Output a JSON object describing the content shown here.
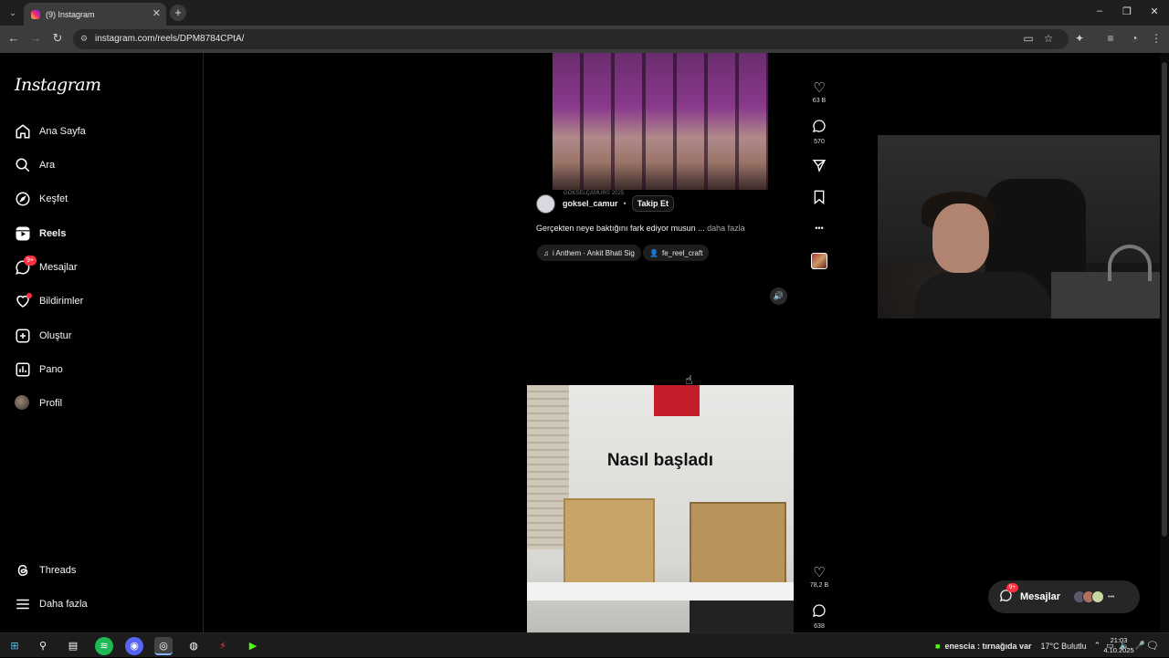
{
  "browser": {
    "tab_title": "(9) Instagram",
    "url": "instagram.com/reels/DPM8784CPtA/",
    "new_tab_symbol": "+"
  },
  "sidebar": {
    "logo": "Instagram",
    "items": [
      {
        "label": "Ana Sayfa",
        "icon": "home-icon"
      },
      {
        "label": "Ara",
        "icon": "search-icon"
      },
      {
        "label": "Keşfet",
        "icon": "compass-icon"
      },
      {
        "label": "Reels",
        "icon": "reels-icon"
      },
      {
        "label": "Mesajlar",
        "icon": "messenger-icon",
        "badge": "9+"
      },
      {
        "label": "Bildirimler",
        "icon": "heart-icon"
      },
      {
        "label": "Oluştur",
        "icon": "plus-square-icon"
      },
      {
        "label": "Pano",
        "icon": "dashboard-icon"
      },
      {
        "label": "Profil",
        "icon": "avatar"
      }
    ],
    "bottom_items": [
      {
        "label": "Threads",
        "icon": "threads-icon"
      },
      {
        "label": "Daha fazla",
        "icon": "menu-icon"
      }
    ]
  },
  "reel1": {
    "watermark": "GÖKSELÇAMUR© 2025",
    "author": "goksel_camur",
    "separator": "•",
    "follow_label": "Takip Et",
    "caption": "Gerçekten neye baktığını fark ediyor musun ...",
    "caption_more": "daha fazla",
    "music_label": "i Anthem · Ankit Bhati Sig",
    "tagged_user": "fe_reel_craft",
    "likes": "63 B",
    "comments": "570",
    "more_symbol": "•••"
  },
  "reel2": {
    "overlay_text": "Nasıl başladı",
    "likes": "78,2 B",
    "comments": "638"
  },
  "messages_float": {
    "label": "Mesajlar",
    "badge": "9+",
    "more_symbol": "•••"
  },
  "taskbar": {
    "media_text": "enescia : tırnağıda var",
    "weather": "17°C  Bulutlu",
    "time": "21:03",
    "date": "4.10.2025"
  },
  "colors": {
    "background": "#000000",
    "badge_red": "#ff3040",
    "chrome_dark": "#1f1f1f",
    "chrome_toolbar": "#3c3c3c"
  }
}
